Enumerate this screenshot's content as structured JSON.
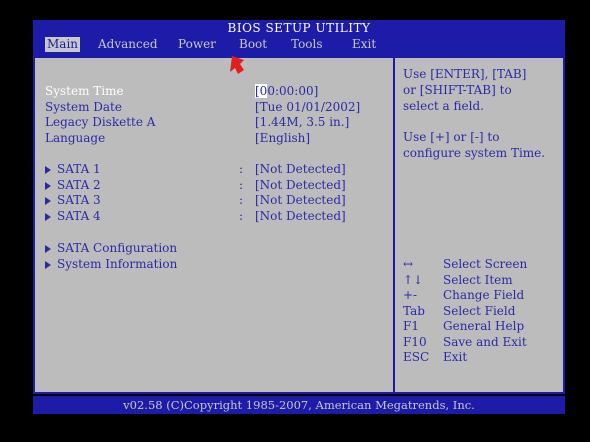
{
  "title": "BIOS SETUP UTILITY",
  "menu": [
    "Main",
    "Advanced",
    "Power",
    "Boot",
    "Tools",
    "Exit"
  ],
  "active_menu": "Main",
  "settings": [
    {
      "label": "System Time",
      "value": "[00:00:00]",
      "highlight": true
    },
    {
      "label": "System Date",
      "value": "[Tue 01/01/2002]"
    },
    {
      "label": "Legacy Diskette A",
      "value": "[1.44M, 3.5 in.]"
    },
    {
      "label": "Language",
      "value": "[English]"
    }
  ],
  "sata": [
    {
      "label": "SATA 1",
      "sep": ":",
      "value": "[Not Detected]"
    },
    {
      "label": "SATA 2",
      "sep": ":",
      "value": "[Not Detected]"
    },
    {
      "label": "SATA 3",
      "sep": ":",
      "value": "[Not Detected]"
    },
    {
      "label": "SATA 4",
      "sep": ":",
      "value": "[Not Detected]"
    }
  ],
  "submenus": [
    "SATA Configuration",
    "System Information"
  ],
  "help_lines": [
    "Use [ENTER], [TAB]",
    "or [SHIFT-TAB] to",
    "select a field.",
    "",
    "Use [+] or [-] to",
    "configure system Time."
  ],
  "keys": [
    {
      "key": "↔",
      "desc": "Select Screen"
    },
    {
      "key": "↑↓",
      "desc": "Select Item"
    },
    {
      "key": "+-",
      "desc": "Change Field"
    },
    {
      "key": "Tab",
      "desc": "Select Field"
    },
    {
      "key": "F1",
      "desc": "General Help"
    },
    {
      "key": "F10",
      "desc": "Save and Exit"
    },
    {
      "key": "ESC",
      "desc": "Exit"
    }
  ],
  "footer": "v02.58 (C)Copyright 1985-2007, American Megatrends, Inc.",
  "colors": {
    "bios_blue": "#1c1ca8",
    "panel_gray": "#bcbcbc",
    "pointer_red": "#e02020"
  },
  "icons": [
    "red-pointer-arrow-icon",
    "right-triangle-icon"
  ]
}
